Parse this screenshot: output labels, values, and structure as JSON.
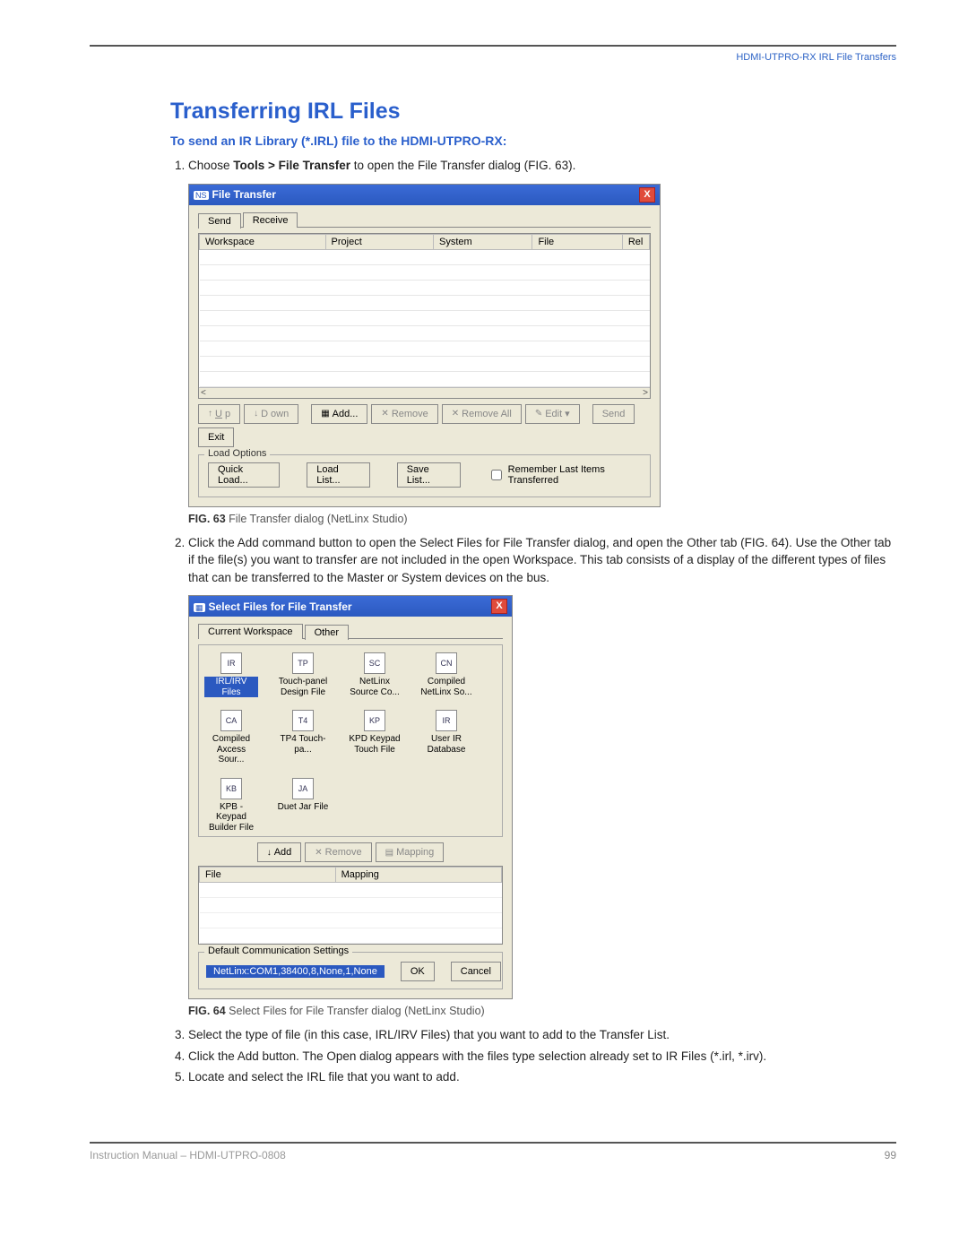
{
  "header": {
    "right": "HDMI-UTPRO-RX IRL File Transfers"
  },
  "heading": "Transferring IRL Files",
  "subheading": "To send an IR Library (*.IRL) file to the HDMI-UTPRO-RX:",
  "steps": {
    "s1a": "Choose ",
    "s1b": "Tools > File Transfer",
    "s1c": " to open the File Transfer dialog (FIG. 63).",
    "s2": "Click the Add command button to open the Select Files for File Transfer dialog, and open the Other tab (FIG. 64). Use the Other tab if the file(s) you want to transfer are not included in the open Workspace. This tab consists of a display of the different types of files that can be transferred to the Master or System devices on the bus.",
    "s3": "Select the type of file (in this case, IRL/IRV Files) that you want to add to the Transfer List.",
    "s4": "Click the Add button. The Open dialog appears with the files type selection already set to IR Files (*.irl, *.irv).",
    "s5": "Locate and select the IRL file that you want to add."
  },
  "fig63": {
    "no": "FIG. 63",
    "caption": " File Transfer dialog (NetLinx Studio)",
    "title": "File Transfer",
    "tabs": {
      "send": "Send",
      "receive": "Receive"
    },
    "cols": {
      "workspace": "Workspace",
      "project": "Project",
      "system": "System",
      "file": "File",
      "rel": "Rel"
    },
    "btns": {
      "up": "Up",
      "down": "Down",
      "add": "Add...",
      "remove": "Remove",
      "removeall": "Remove All",
      "edit": "Edit",
      "send": "Send",
      "exit": "Exit"
    },
    "loadopt": {
      "legend": "Load Options",
      "quick": "Quick Load...",
      "loadlist": "Load List...",
      "savelist": "Save List...",
      "remember": "Remember Last Items Transferred"
    }
  },
  "fig64": {
    "no": "FIG. 64",
    "caption": " Select Files for File Transfer dialog (NetLinx Studio)",
    "title": "Select Files for File Transfer",
    "tabs": {
      "cw": "Current Workspace",
      "other": "Other"
    },
    "icons": [
      "IRL/IRV Files",
      "Touch-panel Design File",
      "NetLinx Source Co...",
      "Compiled NetLinx So...",
      "Compiled Axcess Sour...",
      "TP4 Touch-pa...",
      "KPD Keypad Touch File",
      "User IR Database",
      "KPB - Keypad Builder File",
      "Duet Jar File"
    ],
    "btns": {
      "add": "Add",
      "remove": "Remove",
      "mapping": "Mapping"
    },
    "cols": {
      "file": "File",
      "mapping": "Mapping"
    },
    "commset": {
      "legend": "Default Communication Settings",
      "value": "NetLinx:COM1,38400,8,None,1,None",
      "ok": "OK",
      "cancel": "Cancel"
    }
  },
  "footer": {
    "left": "Instruction Manual – HDMI-UTPRO-0808",
    "page": "99"
  }
}
